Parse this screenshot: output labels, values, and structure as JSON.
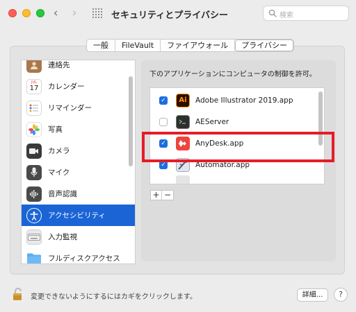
{
  "window": {
    "title": "セキュリティとプライバシー",
    "search_placeholder": "検索",
    "nav_back": "‹",
    "nav_forward": "›"
  },
  "tabs": [
    {
      "label": "一般",
      "active": false
    },
    {
      "label": "FileVault",
      "active": false
    },
    {
      "label": "ファイアウォール",
      "active": false
    },
    {
      "label": "プライバシー",
      "active": true
    }
  ],
  "sidebar": {
    "items": [
      {
        "label": "連絡先",
        "icon": "contacts-icon",
        "color": "#a9774e"
      },
      {
        "label": "カレンダー",
        "icon": "calendar-icon",
        "color": "#ffffff",
        "date_month": "JUL",
        "date_day": "17"
      },
      {
        "label": "リマインダー",
        "icon": "reminders-icon",
        "color": "#ffffff"
      },
      {
        "label": "写真",
        "icon": "photos-icon",
        "color": "#ffffff"
      },
      {
        "label": "カメラ",
        "icon": "camera-icon",
        "color": "#3a3a3a"
      },
      {
        "label": "マイク",
        "icon": "microphone-icon",
        "color": "#4a4a4a"
      },
      {
        "label": "音声認識",
        "icon": "speech-recognition-icon",
        "color": "#4a4a4a"
      },
      {
        "label": "アクセシビリティ",
        "icon": "accessibility-icon",
        "color": "#1a64d6",
        "selected": true
      },
      {
        "label": "入力監視",
        "icon": "keyboard-icon",
        "color": "#e9e9e9"
      },
      {
        "label": "フルディスクアクセス",
        "icon": "folder-icon",
        "color": "#5aaef0"
      }
    ]
  },
  "main": {
    "instruction": "下のアプリケーションにコンピュータの制御を許可。",
    "apps": [
      {
        "name": "Adobe Illustrator 2019.app",
        "checked": true,
        "icon": "illustrator-icon",
        "icon_text": "Ai"
      },
      {
        "name": "AEServer",
        "checked": false,
        "icon": "terminal-icon",
        "icon_text": ""
      },
      {
        "name": "AnyDesk.app",
        "checked": true,
        "icon": "anydesk-icon",
        "icon_text": ""
      },
      {
        "name": "Automator.app",
        "checked": true,
        "icon": "automator-icon",
        "icon_text": ""
      }
    ],
    "add_label": "+",
    "remove_label": "−"
  },
  "footer": {
    "lock_text": "変更できないようにするにはカギをクリックします。",
    "details_label": "詳細...",
    "help_label": "?"
  },
  "colors": {
    "accent": "#1a64d6",
    "highlight_box": "#e51d28"
  }
}
